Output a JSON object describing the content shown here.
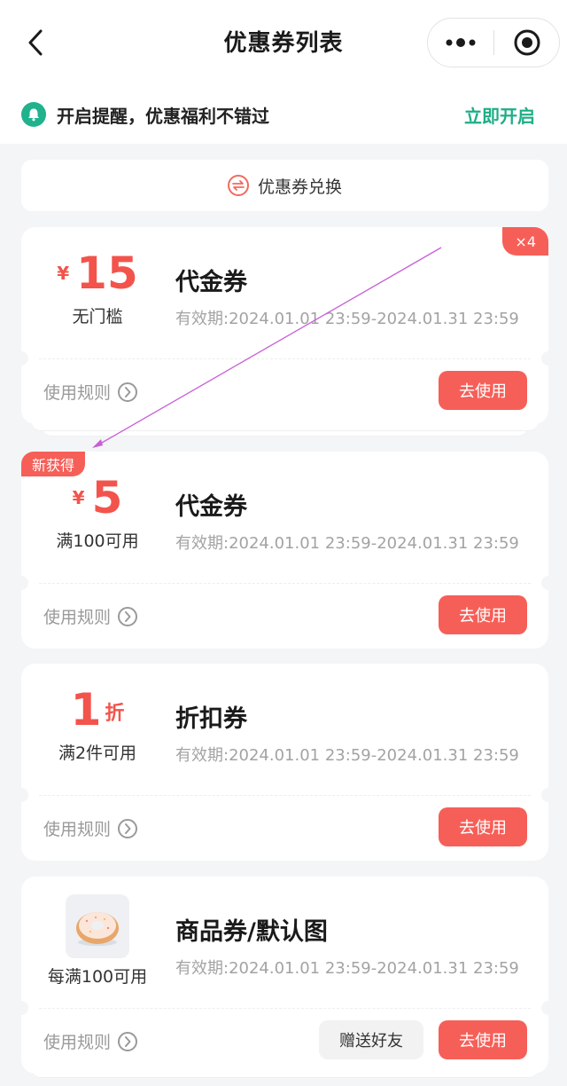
{
  "header": {
    "title": "优惠券列表",
    "back_icon": "chevron-left-icon",
    "more_icon": "more-dots-icon",
    "close_icon": "mini-program-close-icon"
  },
  "notify": {
    "text": "开启提醒，优惠福利不错过",
    "action": "立即开启",
    "icon": "bell-icon",
    "accent": "#1eae86"
  },
  "exchange": {
    "label": "优惠券兑换",
    "icon": "exchange-icon"
  },
  "coupons": [
    {
      "currency": "¥",
      "value": "15",
      "condition": "无门槛",
      "name": "代金券",
      "valid": "有效期:2024.01.01 23:59-2024.01.31 23:59",
      "rules": "使用规则",
      "use": "去使用",
      "count_badge": "×4"
    },
    {
      "currency": "¥",
      "value": "5",
      "condition": "满100可用",
      "name": "代金券",
      "valid": "有效期:2024.01.01 23:59-2024.01.31 23:59",
      "rules": "使用规则",
      "use": "去使用",
      "new_badge": "新获得"
    },
    {
      "value": "1",
      "unit": "折",
      "condition": "满2件可用",
      "name": "折扣券",
      "valid": "有效期:2024.01.01 23:59-2024.01.31 23:59",
      "rules": "使用规则",
      "use": "去使用"
    },
    {
      "image": "donut-image",
      "condition": "每满100可用",
      "name": "商品券/默认图",
      "valid": "有效期:2024.01.01 23:59-2024.01.31 23:59",
      "rules": "使用规则",
      "gift": "赠送好友",
      "use": "去使用"
    }
  ],
  "colors": {
    "primary_red": "#f65f58",
    "price_red": "#f2544c",
    "green": "#20b28c",
    "page_bg": "#f4f5f7"
  }
}
